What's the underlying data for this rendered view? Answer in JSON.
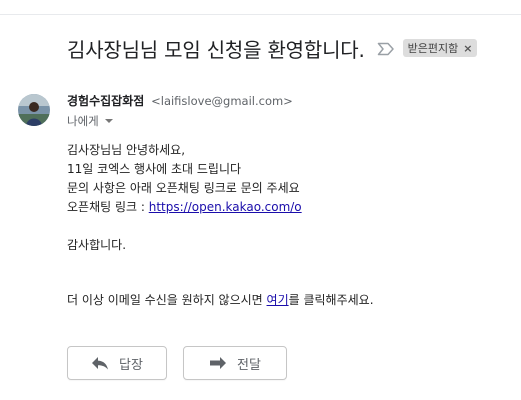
{
  "email": {
    "subject": "김사장님님 모임 신청을 환영합니다.",
    "label": "받은편지함",
    "label_remove": "×",
    "sender": {
      "name": "경험수집잡화점",
      "email": "<laifislove@gmail.com>"
    },
    "recipient": "나에게",
    "body": {
      "line1": "김사장님님 안녕하세요,",
      "line2": "11일 코엑스 행사에 초대 드립니다",
      "line3": "문의 사항은 아래 오픈채팅 링크로 문의 주세요",
      "line4_prefix": "오픈채팅 링크 : ",
      "line4_link": "https://open.kakao.com/o",
      "closing": "감사합니다."
    },
    "optout": {
      "prefix": "더 이상 이메일 수신을 원하지 않으시면 ",
      "link": "여기",
      "suffix": "를 클릭해주세요."
    }
  },
  "actions": {
    "reply": "답장",
    "forward": "전달"
  },
  "icons": {
    "important": "important-marker-icon",
    "label_close": "close-icon",
    "reply": "reply-icon",
    "forward": "forward-icon",
    "caret": "chevron-down-icon"
  },
  "colors": {
    "link": "#1a0dab",
    "label_chip": "#dddddd",
    "text": "#202124",
    "muted": "#5f6368"
  }
}
